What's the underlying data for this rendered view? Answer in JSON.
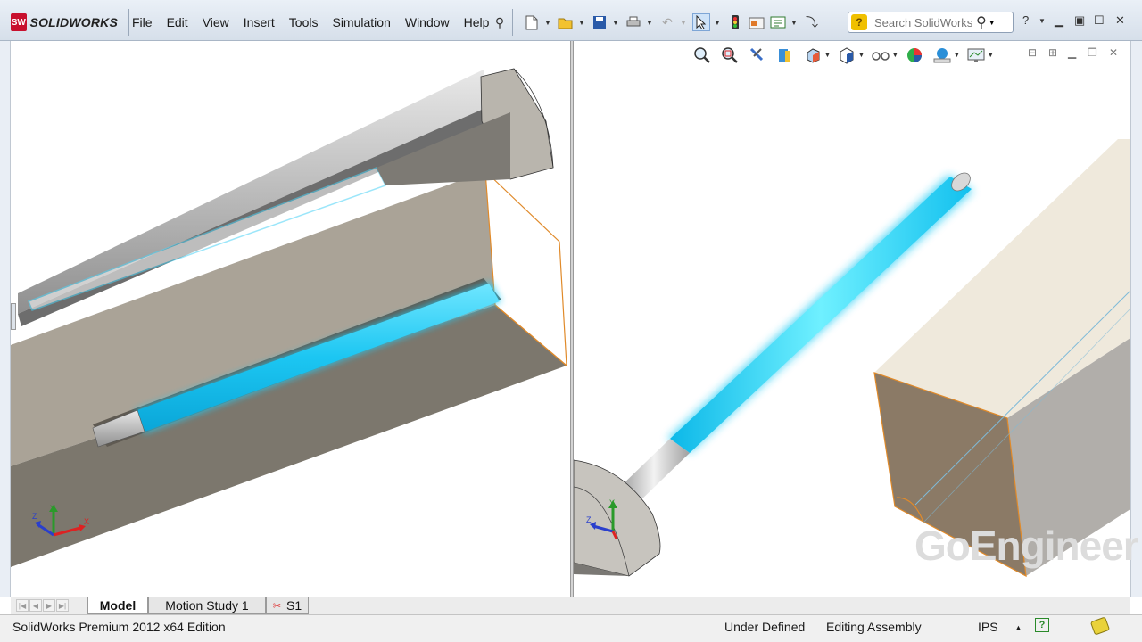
{
  "app": {
    "logo_mark": "SW",
    "logo_text": "SOLIDWORKS"
  },
  "menu": {
    "items": [
      "File",
      "Edit",
      "View",
      "Insert",
      "Tools",
      "Simulation",
      "Window",
      "Help"
    ]
  },
  "toolbar": {
    "icons": [
      "pin-icon",
      "new-document-icon",
      "open-icon",
      "save-icon",
      "print-icon",
      "undo-icon",
      "select-icon",
      "rebuild-icon",
      "options-icon",
      "file-properties-icon"
    ]
  },
  "search": {
    "placeholder": "Search SolidWorks"
  },
  "heads_up_toolbar": {
    "icons": [
      "zoom-to-fit-icon",
      "zoom-to-area-icon",
      "previous-view-icon",
      "section-view-icon",
      "view-orientation-icon",
      "display-style-icon",
      "hide-show-items-icon",
      "edit-appearance-icon",
      "apply-scene-icon",
      "view-settings-icon"
    ]
  },
  "tabs": {
    "model": "Model",
    "motion_study": "Motion Study 1",
    "sketch": "S1"
  },
  "status": {
    "edition": "SolidWorks Premium 2012 x64 Edition",
    "definition": "Under Defined",
    "mode": "Editing Assembly",
    "units": "IPS",
    "units_caret": "▲"
  },
  "watermark": {
    "text": "GoEngineer"
  },
  "colors": {
    "highlight": "#2fd0f5",
    "part_face": "#e8e2d4",
    "part_shade": "#8a8478",
    "edge_orange": "#e08a2a"
  }
}
